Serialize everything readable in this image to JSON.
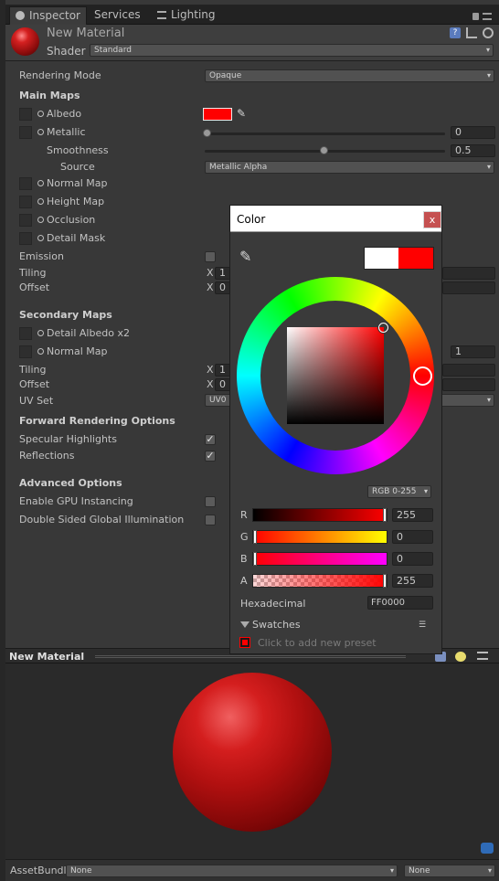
{
  "tabs": {
    "inspector": "Inspector",
    "services": "Services",
    "lighting": "Lighting"
  },
  "header": {
    "title": "New Material",
    "shader_label": "Shader",
    "shader_value": "Standard"
  },
  "rendering_mode": {
    "label": "Rendering Mode",
    "value": "Opaque"
  },
  "main_maps": {
    "heading": "Main Maps",
    "albedo": "Albedo",
    "albedo_color": "#FF0000",
    "metallic": "Metallic",
    "metallic_value": "0",
    "smoothness": "Smoothness",
    "smoothness_value": "0.5",
    "source": "Source",
    "source_value": "Metallic Alpha",
    "normal_map": "Normal Map",
    "height_map": "Height Map",
    "occlusion": "Occlusion",
    "detail_mask": "Detail Mask",
    "emission": "Emission",
    "tiling": "Tiling",
    "tiling_x": "1",
    "offset": "Offset",
    "offset_x": "0",
    "x_label": "X"
  },
  "secondary_maps": {
    "heading": "Secondary Maps",
    "detail_albedo": "Detail Albedo x2",
    "normal_map": "Normal Map",
    "normal_value": "1",
    "tiling": "Tiling",
    "tiling_x": "1",
    "offset": "Offset",
    "offset_x": "0",
    "uv_set": "UV Set",
    "uv_value": "UV0",
    "x_label": "X"
  },
  "forward": {
    "heading": "Forward Rendering Options",
    "specular": "Specular Highlights",
    "specular_checked": true,
    "reflections": "Reflections",
    "reflections_checked": true
  },
  "advanced": {
    "heading": "Advanced Options",
    "gpu_instancing": "Enable GPU Instancing",
    "gpu_instancing_checked": false,
    "double_sided_gi": "Double Sided Global Illumination",
    "double_sided_gi_checked": false
  },
  "preview": {
    "title": "New Material"
  },
  "asset_bundle": {
    "label": "AssetBundle",
    "name_value": "None",
    "variant_value": "None"
  },
  "color_picker": {
    "title": "Color",
    "close": "x",
    "mode": "RGB 0-255",
    "channels": [
      {
        "label": "R",
        "value": "255"
      },
      {
        "label": "G",
        "value": "0"
      },
      {
        "label": "B",
        "value": "0"
      },
      {
        "label": "A",
        "value": "255"
      }
    ],
    "hex_label": "Hexadecimal",
    "hex_value": "FF0000",
    "swatches_label": "Swatches",
    "add_preset": "Click to add new preset",
    "old_color": "#FFFFFF",
    "new_color": "#FF0000"
  },
  "icons": [
    "inspector-icon",
    "lighting-icon",
    "lock-icon",
    "tab-menu-icon",
    "help-icon",
    "preset-icon",
    "gear-icon",
    "eyedropper-icon",
    "close-icon",
    "swatch-menu-icon",
    "tag-icon"
  ]
}
